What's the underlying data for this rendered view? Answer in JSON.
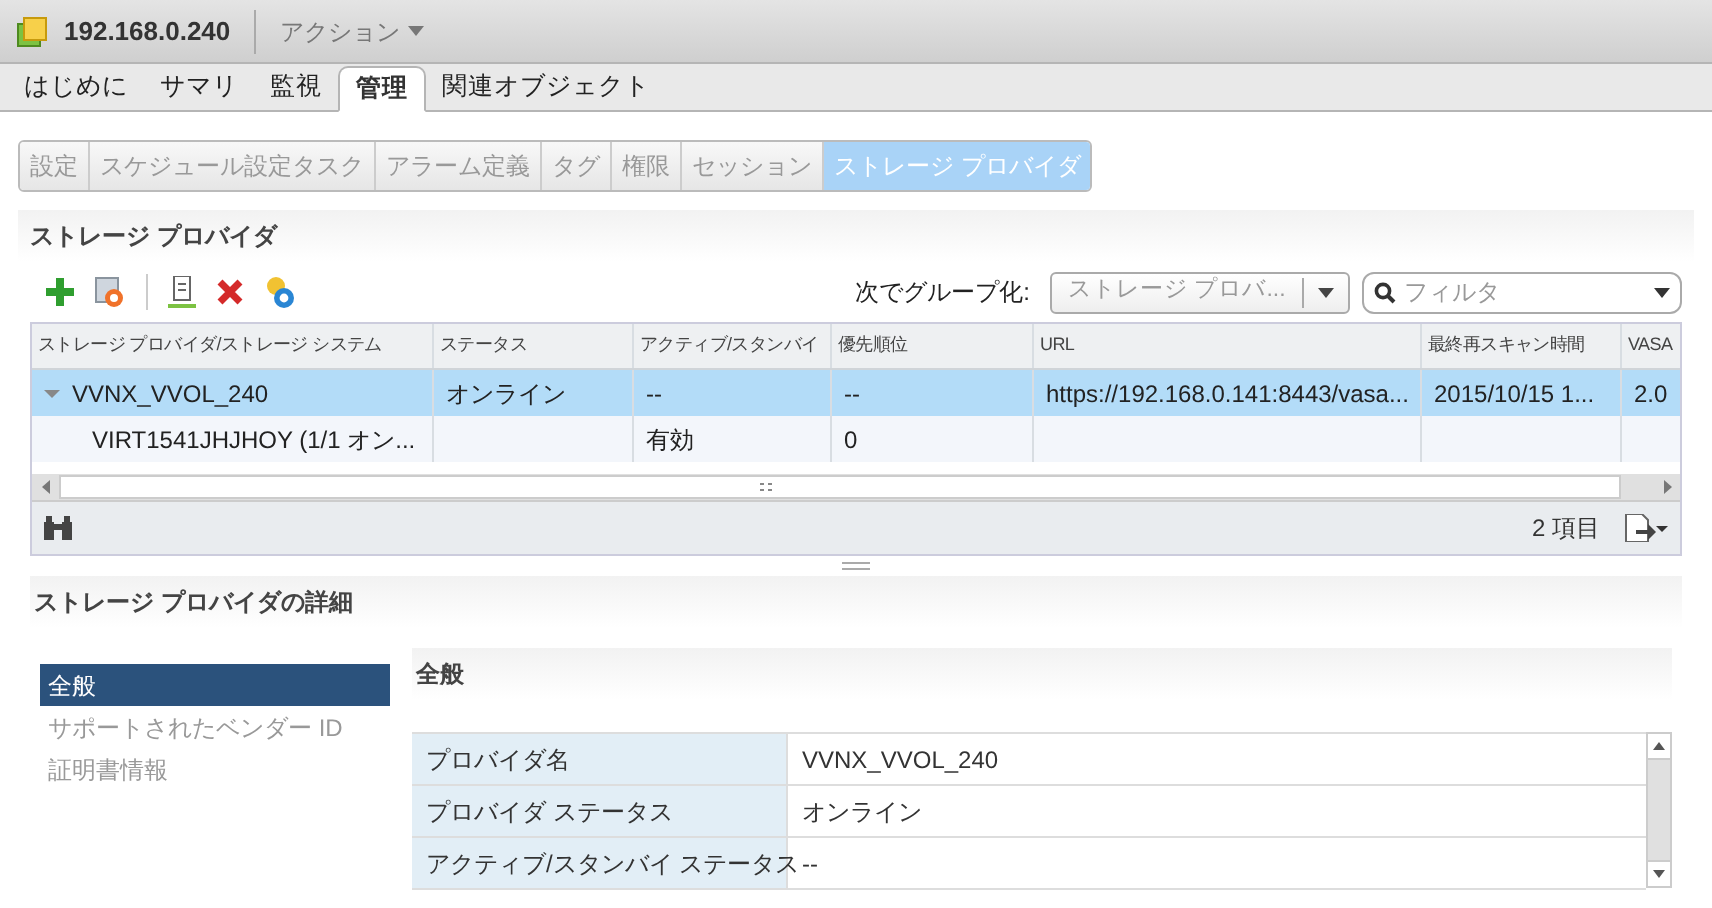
{
  "header": {
    "title": "192.168.0.240",
    "actions_menu": "アクション"
  },
  "tabs": [
    {
      "label": "はじめに",
      "selected": false
    },
    {
      "label": "サマリ",
      "selected": false
    },
    {
      "label": "監視",
      "selected": false
    },
    {
      "label": "管理",
      "selected": true
    },
    {
      "label": "関連オブジェクト",
      "selected": false
    }
  ],
  "subtabs": [
    {
      "label": "設定",
      "selected": false
    },
    {
      "label": "スケジュール設定タスク",
      "selected": false
    },
    {
      "label": "アラーム定義",
      "selected": false
    },
    {
      "label": "タグ",
      "selected": false
    },
    {
      "label": "権限",
      "selected": false
    },
    {
      "label": "セッション",
      "selected": false
    },
    {
      "label": "ストレージ プロバイダ",
      "selected": true
    }
  ],
  "panel": {
    "title": "ストレージ プロバイダ",
    "group_by_label": "次でグループ化:",
    "group_by_value": "ストレージ プロバ...",
    "filter_placeholder": "フィルタ",
    "columns": [
      "ストレージ プロバイダ/ストレージ システム",
      "ステータス",
      "アクティブ/スタンバイ",
      "優先順位",
      "URL",
      "最終再スキャン時間",
      "VASA"
    ],
    "rows": [
      {
        "cells": [
          "VVNX_VVOL_240",
          "オンライン",
          "--",
          "--",
          "https://192.168.0.141:8443/vasa...",
          "2015/10/15 1...",
          "2.0"
        ],
        "expanded": true,
        "selected": true,
        "children": [
          {
            "cells": [
              "VIRT1541JHJHOY (1/1 オン...",
              "",
              "有効",
              "0",
              "",
              "",
              ""
            ],
            "selected": false
          }
        ]
      }
    ],
    "item_count": "2 項目"
  },
  "details": {
    "title": "ストレージ プロバイダの詳細",
    "nav": [
      {
        "label": "全般",
        "selected": true
      },
      {
        "label": "サポートされたベンダー ID",
        "selected": false
      },
      {
        "label": "証明書情報",
        "selected": false
      }
    ],
    "section_title": "全般",
    "properties": [
      {
        "name": "プロバイダ名",
        "value": "VVNX_VVOL_240"
      },
      {
        "name": "プロバイダ ステータス",
        "value": "オンライン"
      },
      {
        "name": "アクティブ/スタンバイ ステータス",
        "value": "--"
      }
    ]
  }
}
